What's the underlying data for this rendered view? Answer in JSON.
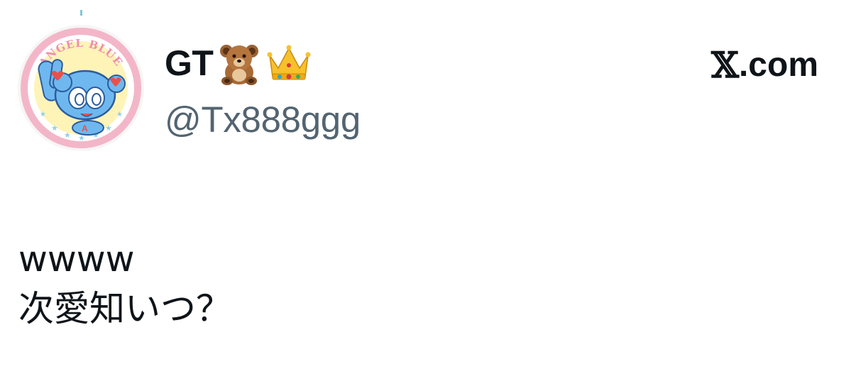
{
  "author": {
    "display_name": "GT",
    "name_emojis": [
      "teddy-bear",
      "crown"
    ],
    "handle": "@Tx888ggg",
    "avatar_badge_text": "ANGEL BLUE"
  },
  "site": {
    "label": ".com",
    "logo_glyph": "𝕏"
  },
  "tweet": {
    "lines": [
      "wwww",
      "次愛知いつ？"
    ]
  },
  "colors": {
    "text": "#0f1419",
    "handle": "#536471",
    "avatar_ring": "#f3b6c8",
    "avatar_inner": "#fff4b8",
    "character_blue": "#6fb8ef"
  }
}
